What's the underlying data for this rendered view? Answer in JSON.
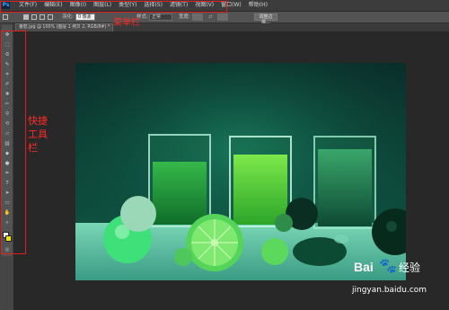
{
  "app_logo": "Ps",
  "menubar": {
    "items": [
      "文件(F)",
      "编辑(E)",
      "图像(I)",
      "图层(L)",
      "类型(Y)",
      "选择(S)",
      "滤镜(T)",
      "视图(V)",
      "窗口(W)",
      "帮助(H)"
    ]
  },
  "options": {
    "feather_label": "羽化:",
    "feather_value": "0 像素",
    "style_label": "样式:",
    "style_value": "正常",
    "width_label": "宽度:",
    "refine_button": "调整边缘..."
  },
  "document_tab": "番茄.jpg @ 100% (图层 1 拷贝 2, RGB/8#) *",
  "annotations": {
    "menubar_label": "菜单栏",
    "toolbar_label": "快捷工具栏",
    "color": "#ff2a2a"
  },
  "toolbar": {
    "icons": [
      "move-icon",
      "marquee-icon",
      "lasso-icon",
      "quick-select-icon",
      "crop-icon",
      "eyedropper-icon",
      "healing-icon",
      "brush-icon",
      "clone-stamp-icon",
      "history-brush-icon",
      "eraser-icon",
      "gradient-icon",
      "blur-icon",
      "dodge-icon",
      "pen-icon",
      "type-icon",
      "path-select-icon",
      "shape-icon",
      "hand-icon",
      "zoom-icon"
    ]
  },
  "watermark": {
    "brand": "Bai",
    "brand_suffix": "经验",
    "url": "jingyan.baidu.com"
  },
  "colors": {
    "menu_bg": "#3c3c3c",
    "panel_bg": "#535353",
    "canvas_bg": "#282828",
    "photo_tint": "#0f6b52"
  }
}
